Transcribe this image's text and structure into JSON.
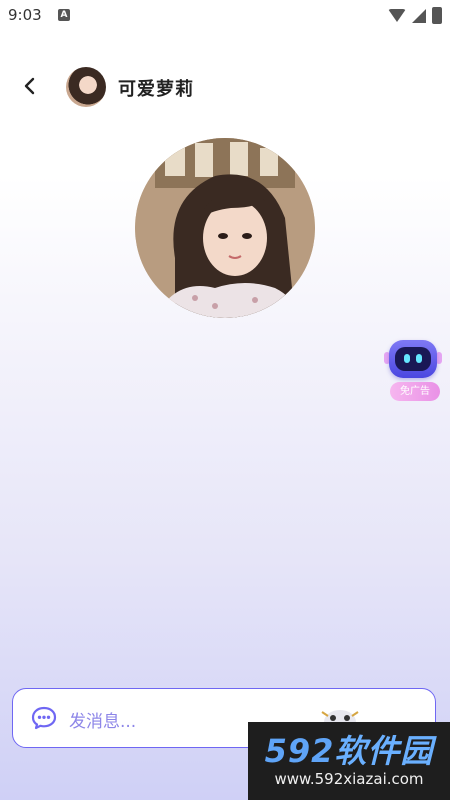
{
  "status_bar": {
    "time": "9:03",
    "notification_letter": "A"
  },
  "header": {
    "name": "可爱萝莉"
  },
  "robot_widget": {
    "badge_label": "免广告"
  },
  "input_bar": {
    "placeholder": "发消息..."
  },
  "watermark": {
    "title_num": "592",
    "title_cn": "软件园",
    "url": "www.592xiazai.com"
  },
  "colors": {
    "accent": "#6f67f3",
    "placeholder": "#8d86e8",
    "watermark_blue": "#5fa4f7"
  }
}
